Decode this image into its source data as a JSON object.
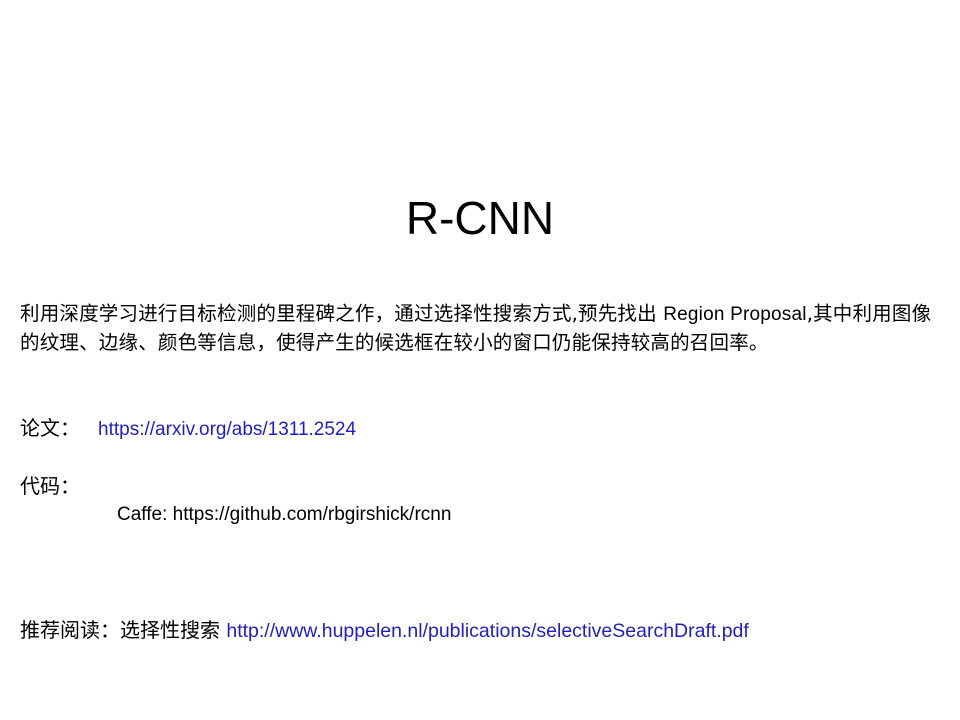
{
  "slide": {
    "title": "R-CNN",
    "intro": {
      "part1": "利用深度学习进行目标检测的里程碑之作，通过选择性搜索方式,预先找出 ",
      "part2": "Region Proposal",
      "part3": ",其中利用图像的纹理、边缘、颜色等信息，使得产生的候选框在较小的窗口仍能保持较高的召回率。"
    },
    "paper": {
      "label": "论文：",
      "link": "https://arxiv.org/abs/1311.2524"
    },
    "code": {
      "label": "代码：",
      "caffe_text": "Caffe:  https://github.com/rbgirshick/rcnn"
    },
    "reading": {
      "label": "推荐阅读：选择性搜索 ",
      "link": "http://www.huppelen.nl/publications/selectiveSearchDraft.pdf"
    }
  }
}
